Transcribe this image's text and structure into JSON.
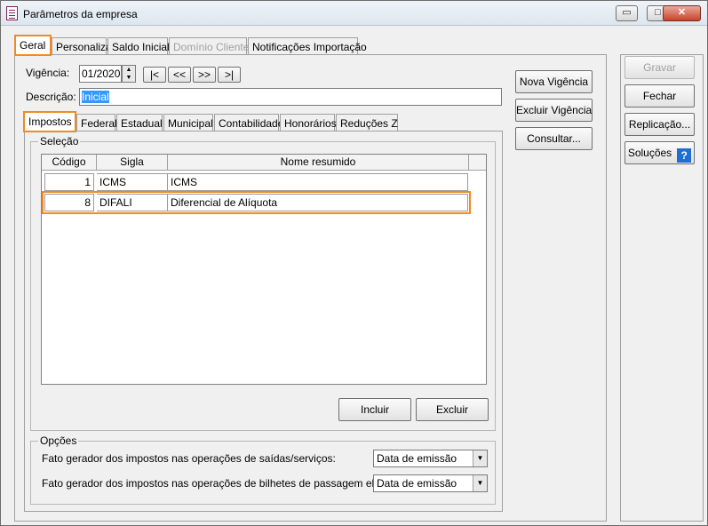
{
  "window": {
    "title": "Parâmetros da empresa"
  },
  "caption": {
    "minimize": "▭",
    "maximize": "□",
    "close": "✕"
  },
  "top_tabs": [
    {
      "label": "Geral"
    },
    {
      "label": "Personaliza"
    },
    {
      "label": "Saldo Inicial"
    },
    {
      "label": "Domínio Cliente"
    },
    {
      "label": "Notificações Importação"
    }
  ],
  "vigencia": {
    "label": "Vigência:",
    "value": "01/2020",
    "nav": [
      "|<",
      "<<",
      ">>",
      ">|"
    ]
  },
  "descricao": {
    "label": "Descrição:",
    "value": "Inicial"
  },
  "inner_tabs": [
    {
      "label": "Impostos"
    },
    {
      "label": "Federal"
    },
    {
      "label": "Estadual"
    },
    {
      "label": "Municipal"
    },
    {
      "label": "Contabilidade"
    },
    {
      "label": "Honorários"
    },
    {
      "label": "Reduções Z"
    }
  ],
  "selecao": {
    "title": "Seleção",
    "columns": [
      "Código",
      "Sigla",
      "Nome resumido"
    ],
    "rows": [
      {
        "codigo": "1",
        "sigla": "ICMS",
        "nome": "ICMS"
      },
      {
        "codigo": "8",
        "sigla": "DIFALI",
        "nome": "Diferencial de Alíquota"
      }
    ],
    "incluir": "Incluir",
    "excluir": "Excluir"
  },
  "opcoes": {
    "title": "Opções",
    "items": [
      {
        "label": "Fato gerador dos impostos nas operações de saídas/serviços:",
        "value": "Data de emissão"
      },
      {
        "label": "Fato gerador dos impostos nas operações de bilhetes de passagem eletrônico:",
        "value": "Data de emissão"
      }
    ]
  },
  "middle_buttons": {
    "nova_vigencia": "Nova Vigência",
    "excluir_vigencia": "Excluir Vigência",
    "consultar": "Consultar..."
  },
  "right_buttons": {
    "gravar": "Gravar",
    "fechar": "Fechar",
    "replicacao": "Replicação...",
    "solucoes": "Soluções",
    "help": "?"
  }
}
